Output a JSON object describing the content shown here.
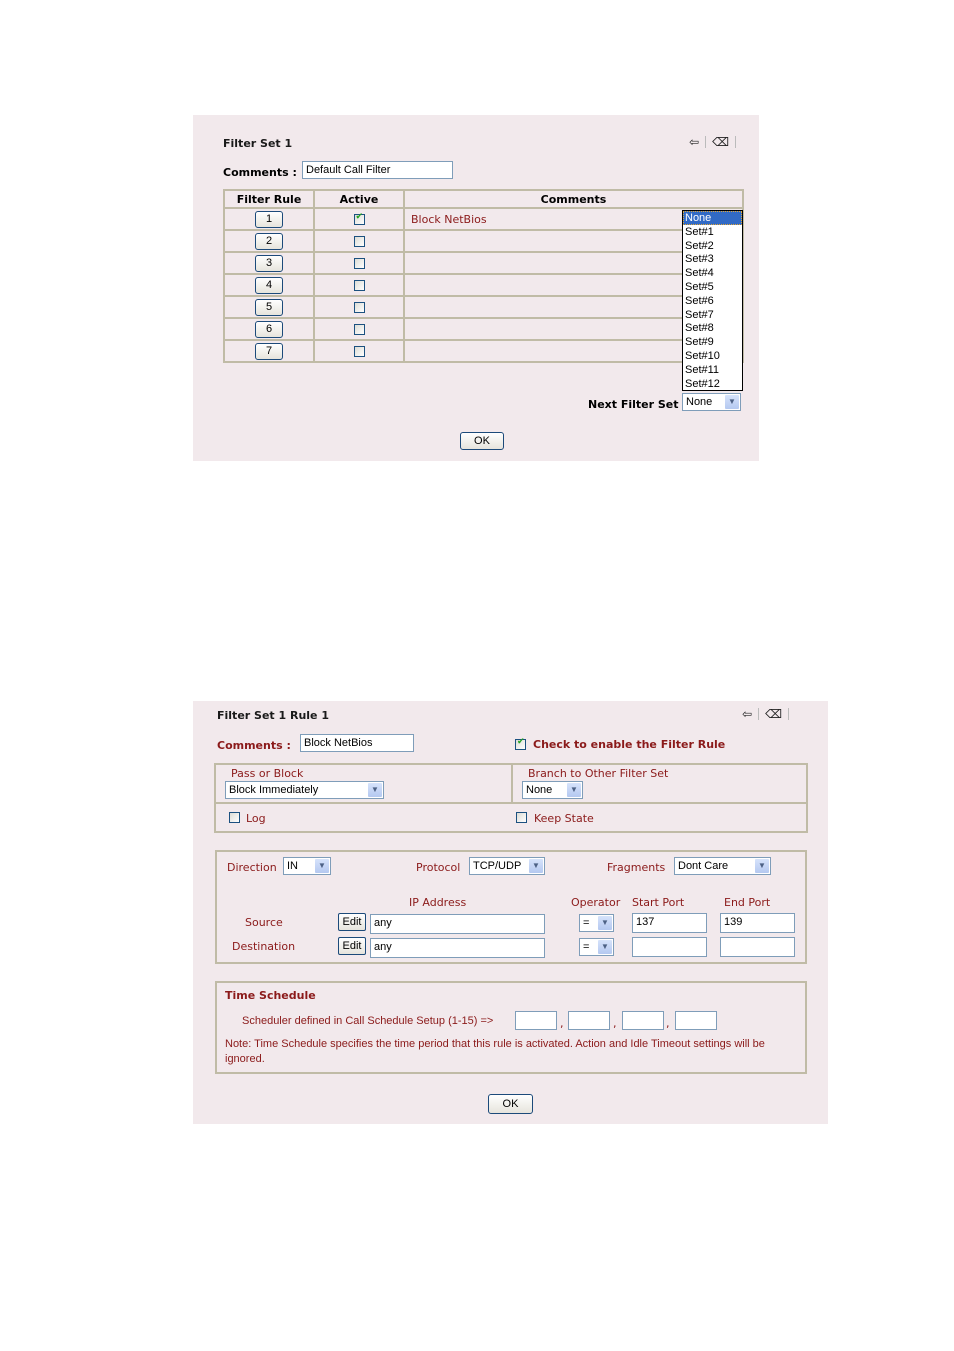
{
  "filter_set": {
    "title": "Filter Set 1",
    "comments_label": "Comments :",
    "comments_value": "Default Call Filter",
    "table": {
      "headers": [
        "Filter Rule",
        "Active",
        "Comments"
      ],
      "rows": [
        {
          "rule": "1",
          "active": true,
          "comment": "Block NetBios"
        },
        {
          "rule": "2",
          "active": false,
          "comment": ""
        },
        {
          "rule": "3",
          "active": false,
          "comment": ""
        },
        {
          "rule": "4",
          "active": false,
          "comment": ""
        },
        {
          "rule": "5",
          "active": false,
          "comment": ""
        },
        {
          "rule": "6",
          "active": false,
          "comment": ""
        },
        {
          "rule": "7",
          "active": false,
          "comment": ""
        }
      ]
    },
    "next_filter_set_label": "Next Filter Set",
    "next_filter_set_value": "None",
    "next_filter_set_options": [
      "None",
      "Set#1",
      "Set#2",
      "Set#3",
      "Set#4",
      "Set#5",
      "Set#6",
      "Set#7",
      "Set#8",
      "Set#9",
      "Set#10",
      "Set#11",
      "Set#12"
    ],
    "ok_label": "OK",
    "icons": [
      "back-arrow-icon",
      "eraser-icon"
    ]
  },
  "filter_rule": {
    "title": "Filter Set 1 Rule 1",
    "comments_label": "Comments :",
    "comments_value": "Block NetBios",
    "enable_label": "Check to enable the Filter Rule",
    "enable_checked": true,
    "pass_or_block_label": "Pass or Block",
    "pass_or_block_value": "Block Immediately",
    "branch_label": "Branch to Other Filter Set",
    "branch_value": "None",
    "log_label": "Log",
    "log_checked": false,
    "keep_state_label": "Keep State",
    "keep_state_checked": false,
    "direction_label": "Direction",
    "direction_value": "IN",
    "protocol_label": "Protocol",
    "protocol_value": "TCP/UDP",
    "fragments_label": "Fragments",
    "fragments_value": "Dont Care",
    "ip_address_header": "IP Address",
    "operator_header": "Operator",
    "start_port_header": "Start Port",
    "end_port_header": "End Port",
    "source": {
      "label": "Source",
      "edit_label": "Edit",
      "ip": "any",
      "operator": "=",
      "start_port": "137",
      "end_port": "139"
    },
    "destination": {
      "label": "Destination",
      "edit_label": "Edit",
      "ip": "any",
      "operator": "=",
      "start_port": "",
      "end_port": ""
    },
    "time_schedule": {
      "title": "Time Schedule",
      "scheduler_label": "Scheduler defined in Call Schedule Setup (1-15) =>",
      "slots": [
        "",
        "",
        "",
        ""
      ],
      "note": "Note: Time Schedule specifies the time period that this rule is activated. Action and Idle Timeout settings will be ignored."
    },
    "ok_label": "OK",
    "icons": [
      "back-arrow-icon",
      "eraser-icon"
    ]
  }
}
